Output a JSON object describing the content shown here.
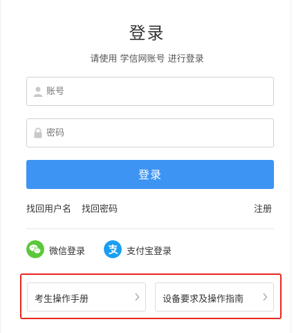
{
  "page": {
    "title": "登录",
    "subtitle": "请使用 学信网账号 进行登录"
  },
  "form": {
    "account_placeholder": "账号",
    "password_placeholder": "密码",
    "login_label": "登录"
  },
  "links": {
    "find_username": "找回用户名",
    "find_password": "找回密码",
    "register": "注册"
  },
  "social": {
    "wechat_label": "微信登录",
    "alipay_label": "支付宝登录"
  },
  "guides": {
    "manual_label": "考生操作手册",
    "requirements_label": "设备要求及操作指南"
  },
  "colors": {
    "primary": "#3d94f2",
    "wechat": "#5dc73b",
    "alipay": "#1a9ef0",
    "highlight": "#e8251f"
  },
  "icons": {
    "account": "user-icon",
    "password": "lock-icon",
    "wechat": "wechat-icon",
    "alipay": "alipay-icon",
    "chevron": "chevron-right-icon"
  }
}
